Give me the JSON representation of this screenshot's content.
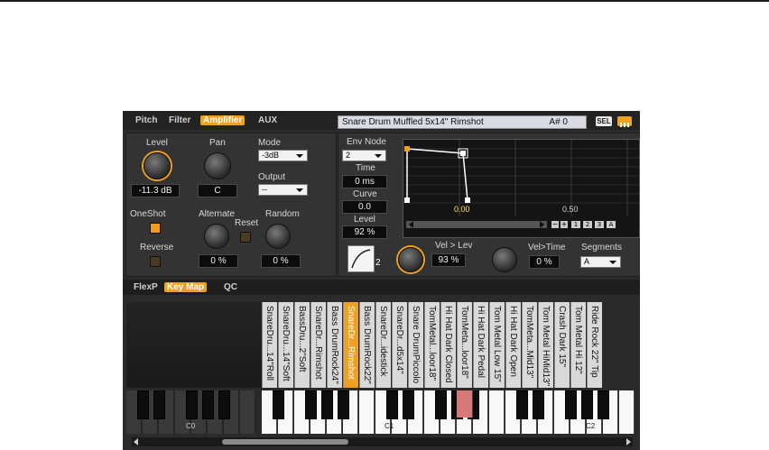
{
  "tabs": [
    "Pitch",
    "Filter",
    "Amplifier",
    "AUX"
  ],
  "active_tab": "Amplifier",
  "zone_name": "Snare Drum Muffled 5x14\" Rimshot",
  "zone_key": "A# 0",
  "sel_label": "SEL",
  "amp": {
    "level_label": "Level",
    "level_value": "-11.3 dB",
    "pan_label": "Pan",
    "pan_value": "C",
    "mode_label": "Mode",
    "mode_value": "-3dB",
    "output_label": "Output",
    "output_value": "--",
    "oneshot_label": "OneShot",
    "reverse_label": "Reverse",
    "alternate_label": "Alternate",
    "alternate_value": "0 %",
    "reset_label": "Reset",
    "random_label": "Random",
    "random_value": "0 %"
  },
  "env": {
    "node_label": "Env Node",
    "node_value": "2",
    "time_label": "Time",
    "time_value": "0 ms",
    "curve_label": "Curve",
    "curve_value": "0.0",
    "level_label": "Level",
    "level_value": "92 %",
    "curve_shape_num": "2",
    "vel_lev_label": "Vel > Lev",
    "vel_lev_value": "93 %",
    "vel_time_label": "Vel>Time",
    "vel_time_value": "0 %",
    "segments_label": "Segments",
    "segments_value": "A",
    "marker_0": "0.00",
    "marker_1": "0.50",
    "graph_buttons": [
      "1",
      "2",
      "3",
      "A"
    ]
  },
  "lower_tabs": [
    "FlexP",
    "Key Map",
    "QC"
  ],
  "lower_active": "Key Map",
  "samples": [
    "SnareDru...14\"Roll",
    "SnareDru...14\"Soft",
    "BassDru...2\"Soft",
    "SnareDr...Rimshot",
    "Bass DrumRock24\"",
    "Bass DrumRock22\"",
    "SnareDr...idestick",
    "SnareDr...d5x14\"",
    "Snare DrumPiccolo",
    "TomMetal...loor18\"",
    "Hi Hat Dark Closed",
    "TomMeta...loor18\"",
    "Hi Hat Dark Pedal",
    "Tom Metal Low 15\"",
    "Hi Hat Dark Open",
    "TomMeta...Mid13\"",
    "Tom Metal HiMid13\"",
    "Crash Dark 15\"",
    "Tom Metal Hi 12\"",
    "Ride Rock 22\" Tip"
  ],
  "selected_sample": "SnareDr...Rimshot",
  "octave_labels": [
    "C0",
    "C1",
    "C2"
  ],
  "colors": {
    "accent": "#f0a020",
    "panel": "#333333",
    "pressed_key": "#d87878"
  }
}
